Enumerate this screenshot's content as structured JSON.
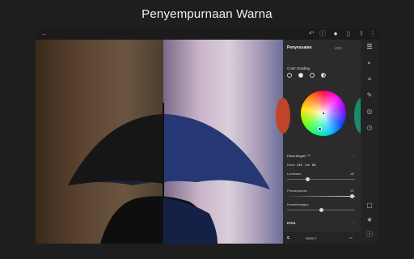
{
  "headline": "Penyempurnaan Warna",
  "panel": {
    "title": "Penyesuaian",
    "sub": "OTO",
    "section": "Color Grading",
    "midtones": "Rona tengah",
    "hue_label": "Rona",
    "hue_value": "245",
    "sat_label": "Sat",
    "sat_value": "88",
    "luminance_label": "Luminans",
    "luminance_value": "-40",
    "luminance_level": 0.3,
    "blending_label": "Pencampuran",
    "blending_value": "57",
    "blending_level": 0.95,
    "balance_label": "Keseimbangan",
    "balance_value": "-20",
    "balance_level": 0.55,
    "effects": "EFEK",
    "reset": "RESET"
  },
  "icons": [
    "back-arrow-icon",
    "undo-icon",
    "info-icon",
    "info-filled-icon",
    "compare-icon",
    "share-icon",
    "more-icon"
  ],
  "rail_icons": [
    "sliders-icon",
    "color-icon",
    "crop-icon",
    "brush-icon",
    "vignette-icon",
    "history-icon",
    "comment-icon",
    "star-icon",
    "info-rail-icon"
  ]
}
